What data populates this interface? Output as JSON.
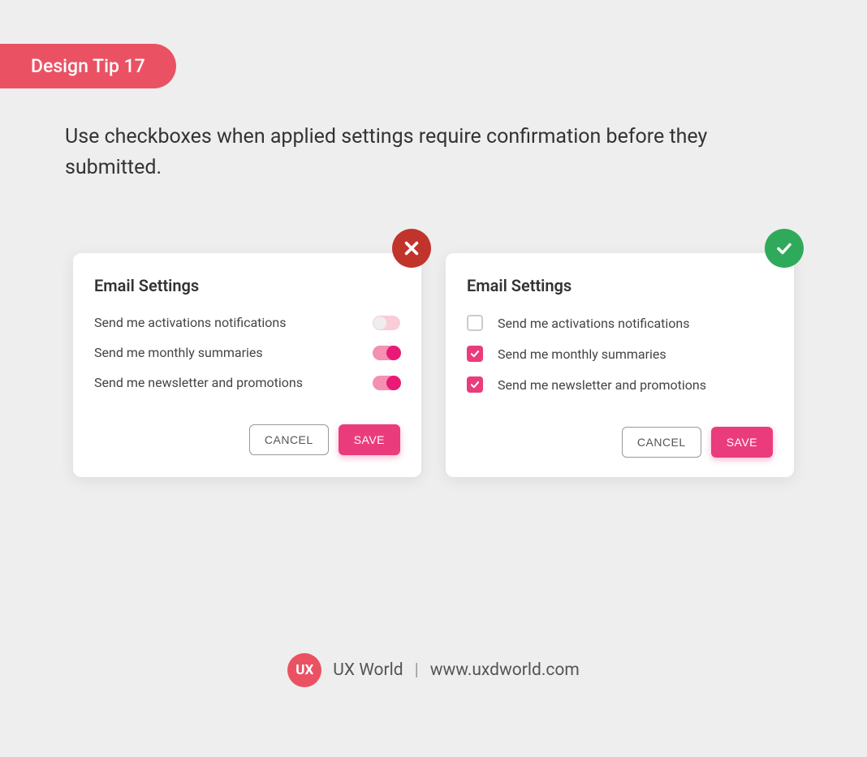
{
  "badge": {
    "label": "Design Tip 17"
  },
  "description": "Use checkboxes when applied settings require confirmation before they submitted.",
  "panels": {
    "dont": {
      "title": "Email Settings",
      "settings": [
        {
          "label": "Send me activations notifications",
          "on": false
        },
        {
          "label": "Send me monthly summaries",
          "on": true
        },
        {
          "label": "Send me newsletter and promotions",
          "on": true
        }
      ],
      "cancel_label": "CANCEL",
      "save_label": "SAVE"
    },
    "do": {
      "title": "Email Settings",
      "settings": [
        {
          "label": "Send me activations notifications",
          "checked": false
        },
        {
          "label": "Send me monthly summaries",
          "checked": true
        },
        {
          "label": "Send me newsletter and promotions",
          "checked": true
        }
      ],
      "cancel_label": "CANCEL",
      "save_label": "SAVE"
    }
  },
  "footer": {
    "logo_text": "UX",
    "brand": "UX World",
    "separator": "|",
    "url": "www.uxdworld.com"
  },
  "colors": {
    "accent_pink": "#ea3c7c",
    "badge_red": "#c0342b",
    "badge_green": "#2faa5b",
    "brand_coral": "#ea5264"
  }
}
